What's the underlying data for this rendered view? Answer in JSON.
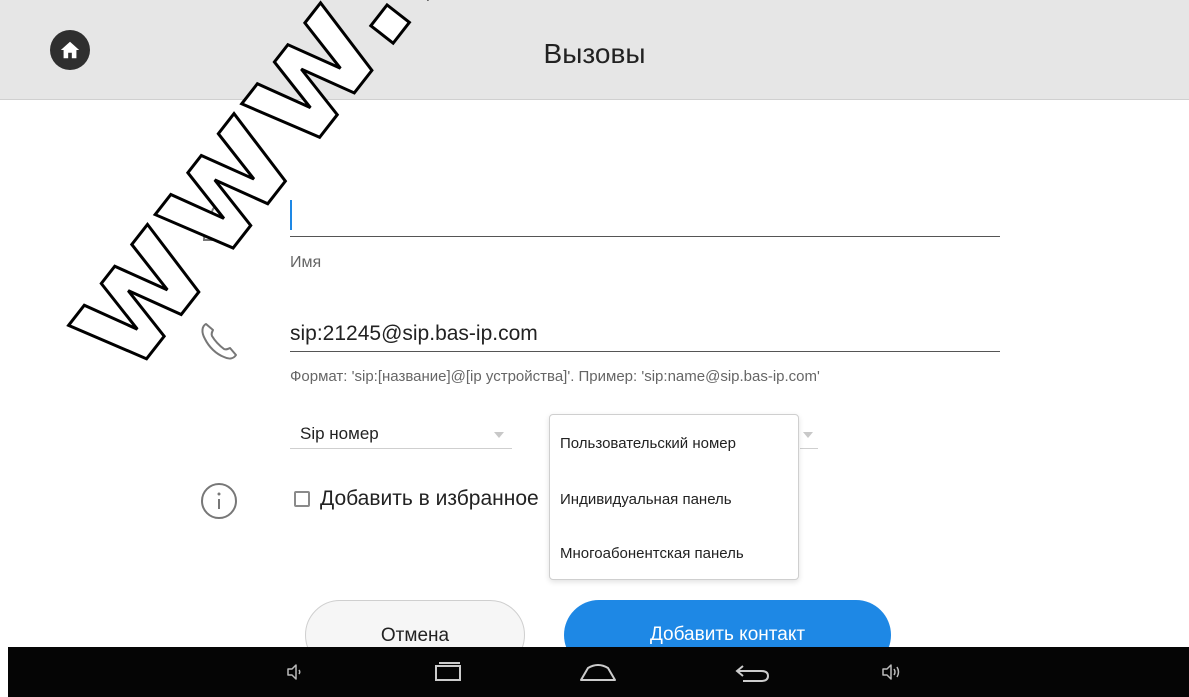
{
  "header": {
    "title": "Вызовы",
    "home_icon": "home-icon"
  },
  "form": {
    "name": {
      "value": "",
      "label": "Имя",
      "icon": "person-icon"
    },
    "sip": {
      "value": "sip:21245@sip.bas-ip.com",
      "hint": "Формат: 'sip:[название]@[ip устройства]'. Пример: 'sip:name@sip.bas-ip.com'",
      "icon": "phone-icon"
    },
    "number_type": {
      "selected": "Sip номер"
    },
    "device_type": {
      "options": [
        "Пользовательский номер",
        "Индивидуальная панель",
        "Многоабонентская панель"
      ]
    },
    "favorite": {
      "label": "Добавить в избранное",
      "checked": false,
      "icon": "info-icon"
    }
  },
  "actions": {
    "cancel_label": "Отмена",
    "add_label": "Добавить контакт"
  },
  "navbar": {
    "icons": [
      "volume-down-icon",
      "recent-apps-icon",
      "home-nav-icon",
      "back-icon",
      "volume-up-icon"
    ]
  },
  "watermark": {
    "text": "www.bezp"
  },
  "colors": {
    "accent": "#1e88e5",
    "topbar": "#e6e6e6",
    "navbar": "#050505"
  }
}
